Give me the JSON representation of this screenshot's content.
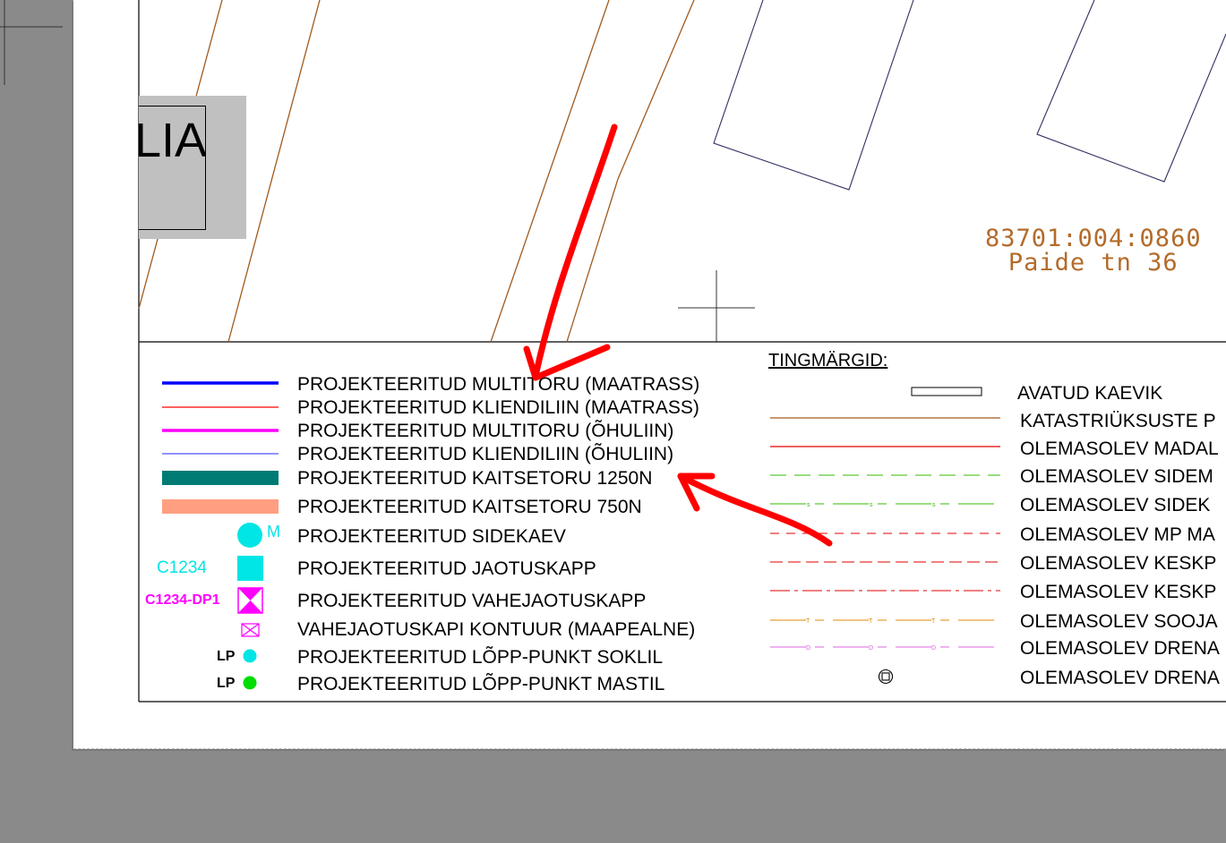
{
  "plan": {
    "title_fragment": "LIA",
    "cadastral_id": "83701:004:0860",
    "address": "Paide tn 36"
  },
  "legend_left": [
    {
      "label": "PROJEKTEERITUD MULTITORU (MAATRASS)",
      "symbol": "line-blue-thick",
      "color": "#0000ff"
    },
    {
      "label": "PROJEKTEERITUD KLIENDILIIN (MAATRASS)",
      "symbol": "line-red-thin",
      "color": "#ff0000"
    },
    {
      "label": "PROJEKTEERITUD MULTITORU (ÕHULIIN)",
      "symbol": "line-magenta-thick",
      "color": "#ff00ff"
    },
    {
      "label": "PROJEKTEERITUD KLIENDILIIN (ÕHULIIN)",
      "symbol": "line-blue-thin",
      "color": "#5050ff"
    },
    {
      "label": "PROJEKTEERITUD KAITSETORU 1250N",
      "symbol": "band-teal",
      "color": "#007b74"
    },
    {
      "label": "PROJEKTEERITUD KAITSETORU 750N",
      "symbol": "band-salmon",
      "color": "#ff9f80"
    },
    {
      "label": "PROJEKTEERITUD SIDEKAEV",
      "symbol": "circle-cyan",
      "color": "#00e5e5",
      "tag": "M"
    },
    {
      "label": "PROJEKTEERITUD JAOTUSKAPP",
      "symbol": "square-cyan",
      "color": "#00e5e5",
      "tag": "C1234"
    },
    {
      "label": "PROJEKTEERITUD VAHEJAOTUSKAPP",
      "symbol": "box-x-magenta",
      "color": "#ff00ff",
      "tag": "C1234-DP1"
    },
    {
      "label": "VAHEJAOTUSKAPI KONTUUR (MAAPEALNE)",
      "symbol": "small-box-x-magenta",
      "color": "#ff00ff"
    },
    {
      "label": "PROJEKTEERITUD LÕPP-PUNKT SOKLIL",
      "symbol": "dot-cyan",
      "color": "#00e5e5",
      "tag": "LP"
    },
    {
      "label": "PROJEKTEERITUD LÕPP-PUNKT MASTIL",
      "symbol": "dot-green",
      "color": "#00dd00",
      "tag": "LP"
    }
  ],
  "legend_right_title": "TINGMÄRGID:",
  "legend_right": [
    {
      "label": "AVATUD KAEVIK",
      "symbol": "rect-outline"
    },
    {
      "label": "KATASTRIÜKSUSTE P",
      "symbol": "line-brown",
      "color": "#a05a1e"
    },
    {
      "label": "OLEMASOLEV MADAL",
      "symbol": "line-red",
      "color": "#e00000"
    },
    {
      "label": "OLEMASOLEV SIDEM",
      "symbol": "dash-green",
      "color": "#33bb00"
    },
    {
      "label": "OLEMASOLEV SIDEK",
      "symbol": "dash-green-s",
      "color": "#33bb00",
      "mark": "s"
    },
    {
      "label": "OLEMASOLEV MP MA",
      "symbol": "dash-red-short",
      "color": "#e00000"
    },
    {
      "label": "OLEMASOLEV KESKP",
      "symbol": "dash-red",
      "color": "#e00000"
    },
    {
      "label": "OLEMASOLEV KESKP",
      "symbol": "dashdot-red",
      "color": "#e00000"
    },
    {
      "label": "OLEMASOLEV SOOJA",
      "symbol": "dash-orange-t",
      "color": "#e08a00",
      "mark": "T"
    },
    {
      "label": "OLEMASOLEV DRENA",
      "symbol": "dash-pink-d",
      "color": "#dd66dd",
      "mark": "D"
    },
    {
      "label": "OLEMASOLEV DRENA",
      "symbol": "drain-circle"
    }
  ],
  "annotation_color": "#ff0000"
}
